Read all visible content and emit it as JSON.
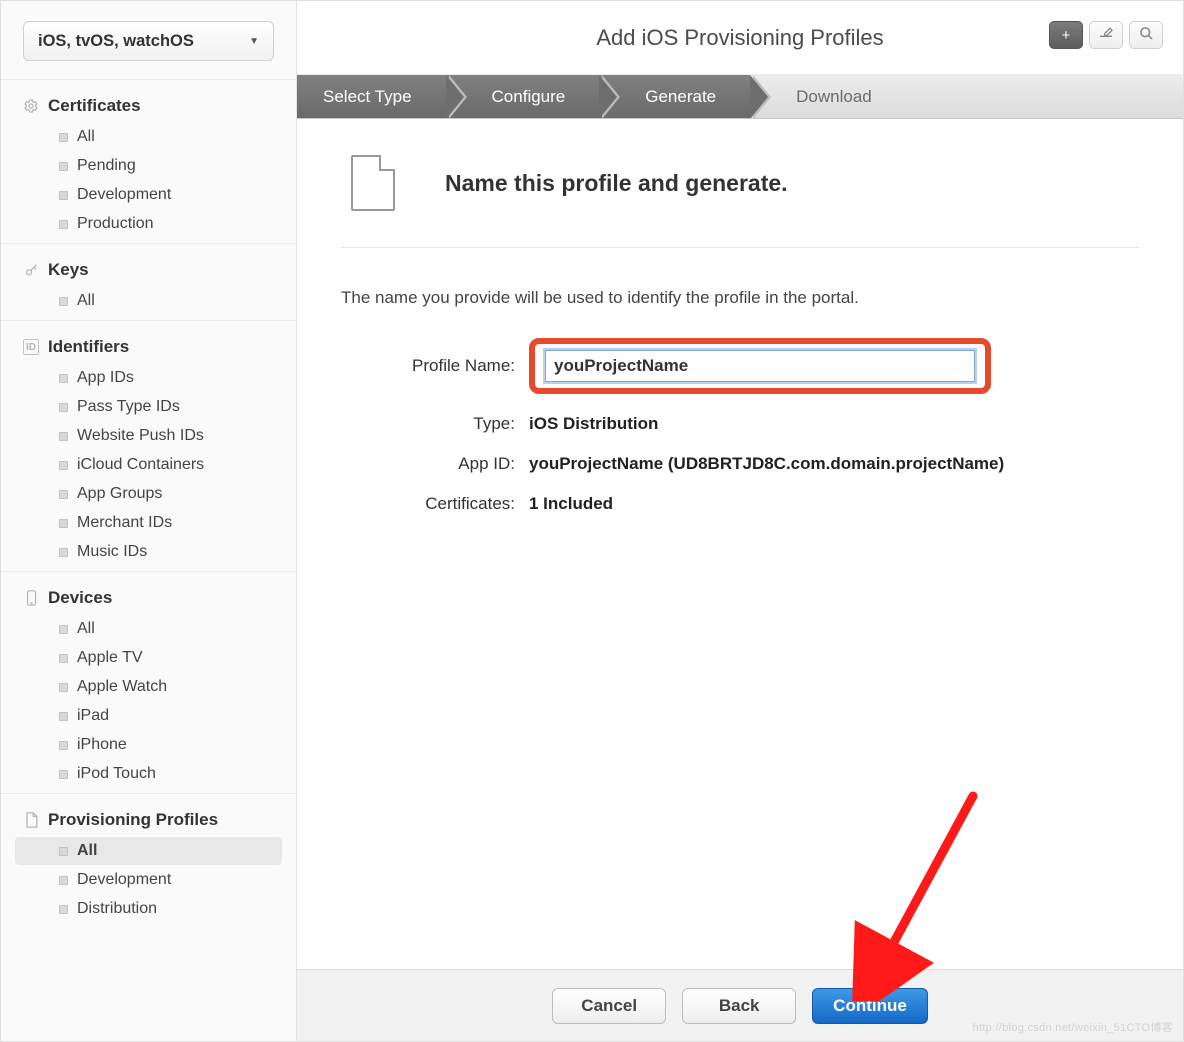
{
  "platformSelector": "iOS, tvOS, watchOS",
  "sidebar": {
    "sections": [
      {
        "title": "Certificates",
        "icon": "gear-icon",
        "items": [
          {
            "label": "All",
            "active": false
          },
          {
            "label": "Pending",
            "active": false
          },
          {
            "label": "Development",
            "active": false
          },
          {
            "label": "Production",
            "active": false
          }
        ]
      },
      {
        "title": "Keys",
        "icon": "key-icon",
        "items": [
          {
            "label": "All",
            "active": false
          }
        ]
      },
      {
        "title": "Identifiers",
        "icon": "id-icon",
        "items": [
          {
            "label": "App IDs",
            "active": false
          },
          {
            "label": "Pass Type IDs",
            "active": false
          },
          {
            "label": "Website Push IDs",
            "active": false
          },
          {
            "label": "iCloud Containers",
            "active": false
          },
          {
            "label": "App Groups",
            "active": false
          },
          {
            "label": "Merchant IDs",
            "active": false
          },
          {
            "label": "Music IDs",
            "active": false
          }
        ]
      },
      {
        "title": "Devices",
        "icon": "device-icon",
        "items": [
          {
            "label": "All",
            "active": false
          },
          {
            "label": "Apple TV",
            "active": false
          },
          {
            "label": "Apple Watch",
            "active": false
          },
          {
            "label": "iPad",
            "active": false
          },
          {
            "label": "iPhone",
            "active": false
          },
          {
            "label": "iPod Touch",
            "active": false
          }
        ]
      },
      {
        "title": "Provisioning Profiles",
        "icon": "document-icon",
        "items": [
          {
            "label": "All",
            "active": true
          },
          {
            "label": "Development",
            "active": false
          },
          {
            "label": "Distribution",
            "active": false
          }
        ]
      }
    ]
  },
  "header": {
    "title": "Add iOS Provisioning Profiles"
  },
  "toolbar": {
    "add": "+",
    "edit": "edit-icon",
    "search": "search-icon"
  },
  "steps": [
    {
      "label": "Select Type",
      "active": true
    },
    {
      "label": "Configure",
      "active": true
    },
    {
      "label": "Generate",
      "active": true
    },
    {
      "label": "Download",
      "active": false
    }
  ],
  "content": {
    "heading": "Name this profile and generate.",
    "hint": "The name you provide will be used to identify the profile in the portal.",
    "fields": {
      "profileNameLabel": "Profile Name:",
      "profileNameValue": "youProjectName",
      "typeLabel": "Type:",
      "typeValue": "iOS Distribution",
      "appIdLabel": "App ID:",
      "appIdValue": "youProjectName (UD8BRTJD8C.com.domain.projectName)",
      "certificatesLabel": "Certificates:",
      "certificatesValue": "1 Included"
    }
  },
  "footer": {
    "cancel": "Cancel",
    "back": "Back",
    "continue": "Continue"
  },
  "annotation": {
    "highlight_color": "#e8492b",
    "arrow_color": "#ff1a1a"
  },
  "watermark": "http://blog.csdn.net/weixin_51CTO博客"
}
